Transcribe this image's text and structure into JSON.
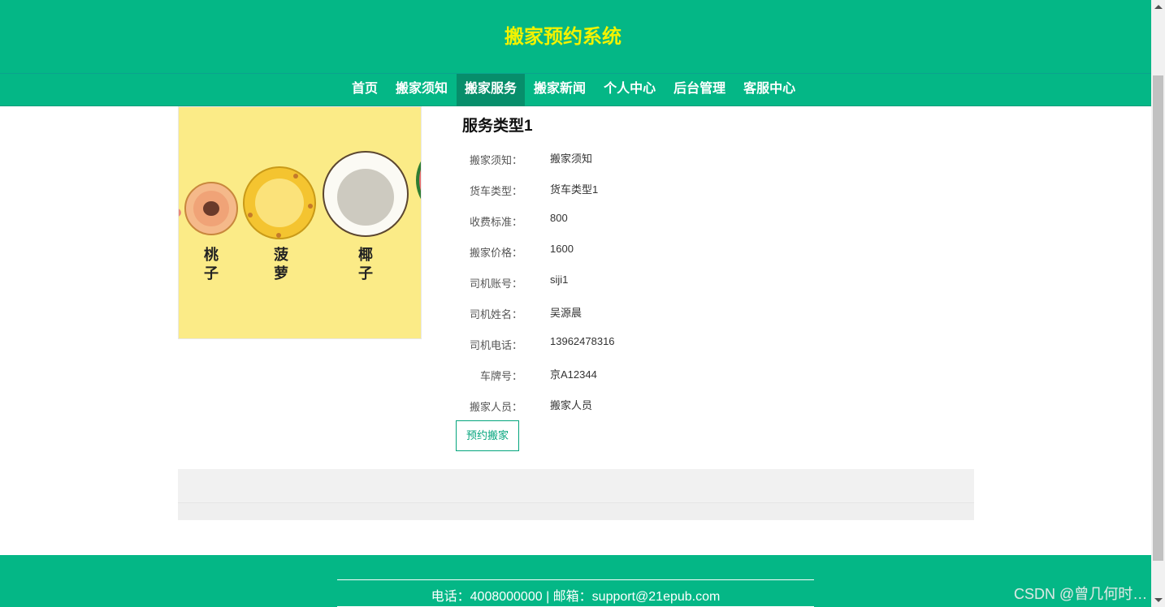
{
  "header": {
    "title": "搬家预约系统"
  },
  "nav": {
    "items": [
      {
        "label": "首页",
        "active": false
      },
      {
        "label": "搬家须知",
        "active": false
      },
      {
        "label": "搬家服务",
        "active": true
      },
      {
        "label": "搬家新闻",
        "active": false
      },
      {
        "label": "个人中心",
        "active": false
      },
      {
        "label": "后台管理",
        "active": false
      },
      {
        "label": "客服中心",
        "active": false
      }
    ]
  },
  "product": {
    "image_alt": "fruit illustration",
    "image_labels": [
      "桃子",
      "菠萝",
      "椰子"
    ],
    "colors": {
      "background": "#fbeb87"
    }
  },
  "detail": {
    "title": "服务类型1",
    "fields": [
      {
        "label": "搬家须知：",
        "value": "搬家须知"
      },
      {
        "label": "货车类型：",
        "value": "货车类型1"
      },
      {
        "label": "收费标准：",
        "value": "800"
      },
      {
        "label": "搬家价格：",
        "value": "1600"
      },
      {
        "label": "司机账号：",
        "value": "siji1"
      },
      {
        "label": "司机姓名：",
        "value": "吴源晨"
      },
      {
        "label": "司机电话：",
        "value": "13962478316"
      },
      {
        "label": "车牌号：",
        "value": "京A12344"
      },
      {
        "label": "搬家人员：",
        "value": "搬家人员"
      }
    ],
    "book_button": "预约搬家"
  },
  "footer": {
    "text": "电话：4008000000 | 邮箱：support@21epub.com"
  },
  "watermark": "CSDN @曾几何时…",
  "colors": {
    "brand": "#04b786",
    "title": "#f2f200",
    "active_nav": "#078e6b"
  }
}
